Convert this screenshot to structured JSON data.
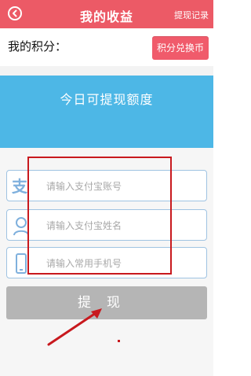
{
  "header": {
    "title": "我的收益",
    "right_link": "提现记录",
    "back_icon": "back-arrow-circle-icon"
  },
  "points": {
    "label": "我的积分：",
    "shop_button": "积分兑换币"
  },
  "quota": {
    "title": "今日可提现额度"
  },
  "form": {
    "alipay_account_placeholder": "请输入支付宝账号",
    "alipay_name_placeholder": "请输入支付宝姓名",
    "phone_placeholder": "请输入常用手机号"
  },
  "submit": {
    "label": "提现"
  },
  "colors": {
    "header": "#ec5a66",
    "quota_card": "#4db7e6",
    "submit_disabled": "#b5b5b5",
    "annotation": "#c8191e"
  }
}
